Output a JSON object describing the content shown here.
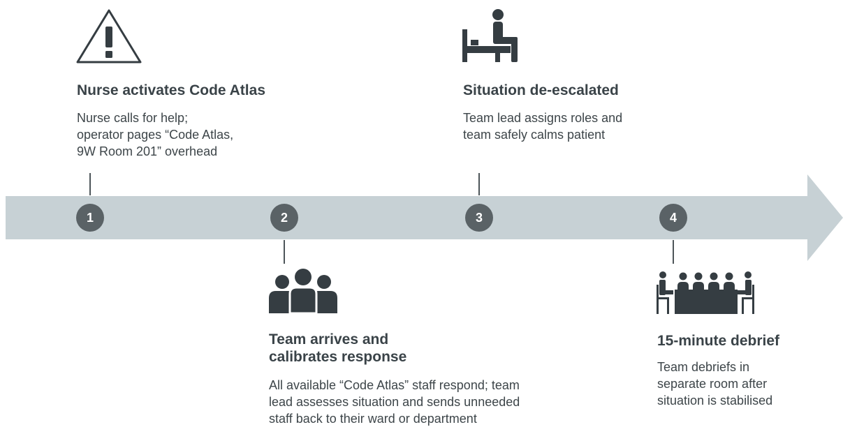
{
  "colors": {
    "arrow": "#c7d1d5",
    "badge": "#5a6266",
    "icon": "#353d42",
    "text": "#3d4549"
  },
  "steps": [
    {
      "number": "1",
      "icon": "warning-icon",
      "title": "Nurse activates Code Atlas",
      "description": "Nurse calls for help;\noperator pages “Code Atlas,\n9W Room 201” overhead"
    },
    {
      "number": "2",
      "icon": "team-icon",
      "title": "Team arrives and\ncalibrates response",
      "description": "All available “Code Atlas” staff respond; team\nlead assesses situation and sends unneeded\nstaff back to their ward or department"
    },
    {
      "number": "3",
      "icon": "patient-bed-icon",
      "title": "Situation de-escalated",
      "description": "Team lead assigns roles and\nteam safely calms patient"
    },
    {
      "number": "4",
      "icon": "meeting-table-icon",
      "title": "15-minute debrief",
      "description": "Team debriefs in\nseparate room after\nsituation is stabilised"
    }
  ]
}
